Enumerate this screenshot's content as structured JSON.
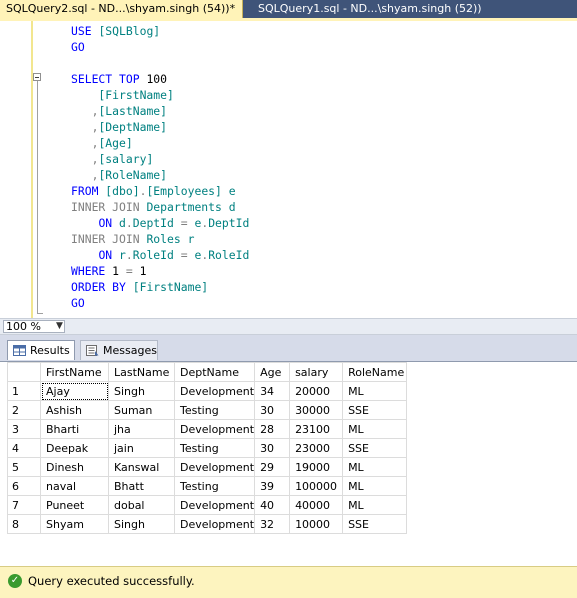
{
  "tabs": [
    {
      "label": "SQLQuery2.sql - ND...\\shyam.singh (54))*"
    },
    {
      "label": "SQLQuery1.sql - ND...\\shyam.singh (52))"
    }
  ],
  "editor": {
    "lines": [
      [
        {
          "t": "USE ",
          "c": "kw"
        },
        {
          "t": "[SQLBlog]",
          "c": "id"
        }
      ],
      [
        {
          "t": "GO",
          "c": "kw"
        }
      ],
      [
        {
          "t": "",
          "c": "tx"
        }
      ],
      [
        {
          "t": "SELECT ",
          "c": "kw"
        },
        {
          "t": "TOP ",
          "c": "kw"
        },
        {
          "t": "100",
          "c": "tx"
        }
      ],
      [
        {
          "t": "    [FirstName]",
          "c": "id"
        }
      ],
      [
        {
          "t": "   ",
          "c": "tx"
        },
        {
          "t": ",",
          "c": "gr"
        },
        {
          "t": "[LastName]",
          "c": "id"
        }
      ],
      [
        {
          "t": "   ",
          "c": "tx"
        },
        {
          "t": ",",
          "c": "gr"
        },
        {
          "t": "[DeptName]",
          "c": "id"
        }
      ],
      [
        {
          "t": "   ",
          "c": "tx"
        },
        {
          "t": ",",
          "c": "gr"
        },
        {
          "t": "[Age]",
          "c": "id"
        }
      ],
      [
        {
          "t": "   ",
          "c": "tx"
        },
        {
          "t": ",",
          "c": "gr"
        },
        {
          "t": "[salary]",
          "c": "id"
        }
      ],
      [
        {
          "t": "   ",
          "c": "tx"
        },
        {
          "t": ",",
          "c": "gr"
        },
        {
          "t": "[RoleName]",
          "c": "id"
        }
      ],
      [
        {
          "t": "FROM ",
          "c": "kw"
        },
        {
          "t": "[dbo]",
          "c": "id"
        },
        {
          "t": ".",
          "c": "gr"
        },
        {
          "t": "[Employees] ",
          "c": "id"
        },
        {
          "t": "e",
          "c": "id"
        }
      ],
      [
        {
          "t": "INNER JOIN ",
          "c": "gr"
        },
        {
          "t": "Departments ",
          "c": "id"
        },
        {
          "t": "d",
          "c": "id"
        }
      ],
      [
        {
          "t": "    ",
          "c": "tx"
        },
        {
          "t": "ON ",
          "c": "kw"
        },
        {
          "t": "d",
          "c": "id"
        },
        {
          "t": ".",
          "c": "gr"
        },
        {
          "t": "DeptId ",
          "c": "id"
        },
        {
          "t": "= ",
          "c": "gr"
        },
        {
          "t": "e",
          "c": "id"
        },
        {
          "t": ".",
          "c": "gr"
        },
        {
          "t": "DeptId",
          "c": "id"
        }
      ],
      [
        {
          "t": "INNER JOIN ",
          "c": "gr"
        },
        {
          "t": "Roles ",
          "c": "id"
        },
        {
          "t": "r",
          "c": "id"
        }
      ],
      [
        {
          "t": "    ",
          "c": "tx"
        },
        {
          "t": "ON ",
          "c": "kw"
        },
        {
          "t": "r",
          "c": "id"
        },
        {
          "t": ".",
          "c": "gr"
        },
        {
          "t": "RoleId ",
          "c": "id"
        },
        {
          "t": "= ",
          "c": "gr"
        },
        {
          "t": "e",
          "c": "id"
        },
        {
          "t": ".",
          "c": "gr"
        },
        {
          "t": "RoleId",
          "c": "id"
        }
      ],
      [
        {
          "t": "WHERE ",
          "c": "kw"
        },
        {
          "t": "1 ",
          "c": "tx"
        },
        {
          "t": "= ",
          "c": "gr"
        },
        {
          "t": "1",
          "c": "tx"
        }
      ],
      [
        {
          "t": "ORDER BY ",
          "c": "kw"
        },
        {
          "t": "[FirstName]",
          "c": "id"
        }
      ],
      [
        {
          "t": "GO",
          "c": "kw"
        }
      ]
    ]
  },
  "zoom": {
    "value": "100 %"
  },
  "result_tabs": [
    {
      "label": "Results"
    },
    {
      "label": "Messages"
    }
  ],
  "grid": {
    "columns": [
      "FirstName",
      "LastName",
      "DeptName",
      "Age",
      "salary",
      "RoleName"
    ],
    "rows": [
      [
        "1",
        "Ajay",
        "Singh",
        "Development",
        "34",
        "20000",
        "ML"
      ],
      [
        "2",
        "Ashish",
        "Suman",
        "Testing",
        "30",
        "30000",
        "SSE"
      ],
      [
        "3",
        "Bharti",
        "jha",
        "Development",
        "28",
        "23100",
        "ML"
      ],
      [
        "4",
        "Deepak",
        "jain",
        "Testing",
        "30",
        "23000",
        "SSE"
      ],
      [
        "5",
        "Dinesh",
        "Kanswal",
        "Development",
        "29",
        "19000",
        "ML"
      ],
      [
        "6",
        "naval",
        "Bhatt",
        "Testing",
        "39",
        "100000",
        "ML"
      ],
      [
        "7",
        "Puneet",
        "dobal",
        "Development",
        "40",
        "40000",
        "ML"
      ],
      [
        "8",
        "Shyam",
        "Singh",
        "Development",
        "32",
        "10000",
        "SSE"
      ]
    ]
  },
  "status": {
    "text": "Query executed successfully."
  },
  "colors": {
    "tabstrip": "#3f5479",
    "active_tab": "#fff3b8",
    "keyword": "#0000ff",
    "identifier": "#008080",
    "operator": "#808080",
    "status_bar": "#fdf4bf"
  }
}
